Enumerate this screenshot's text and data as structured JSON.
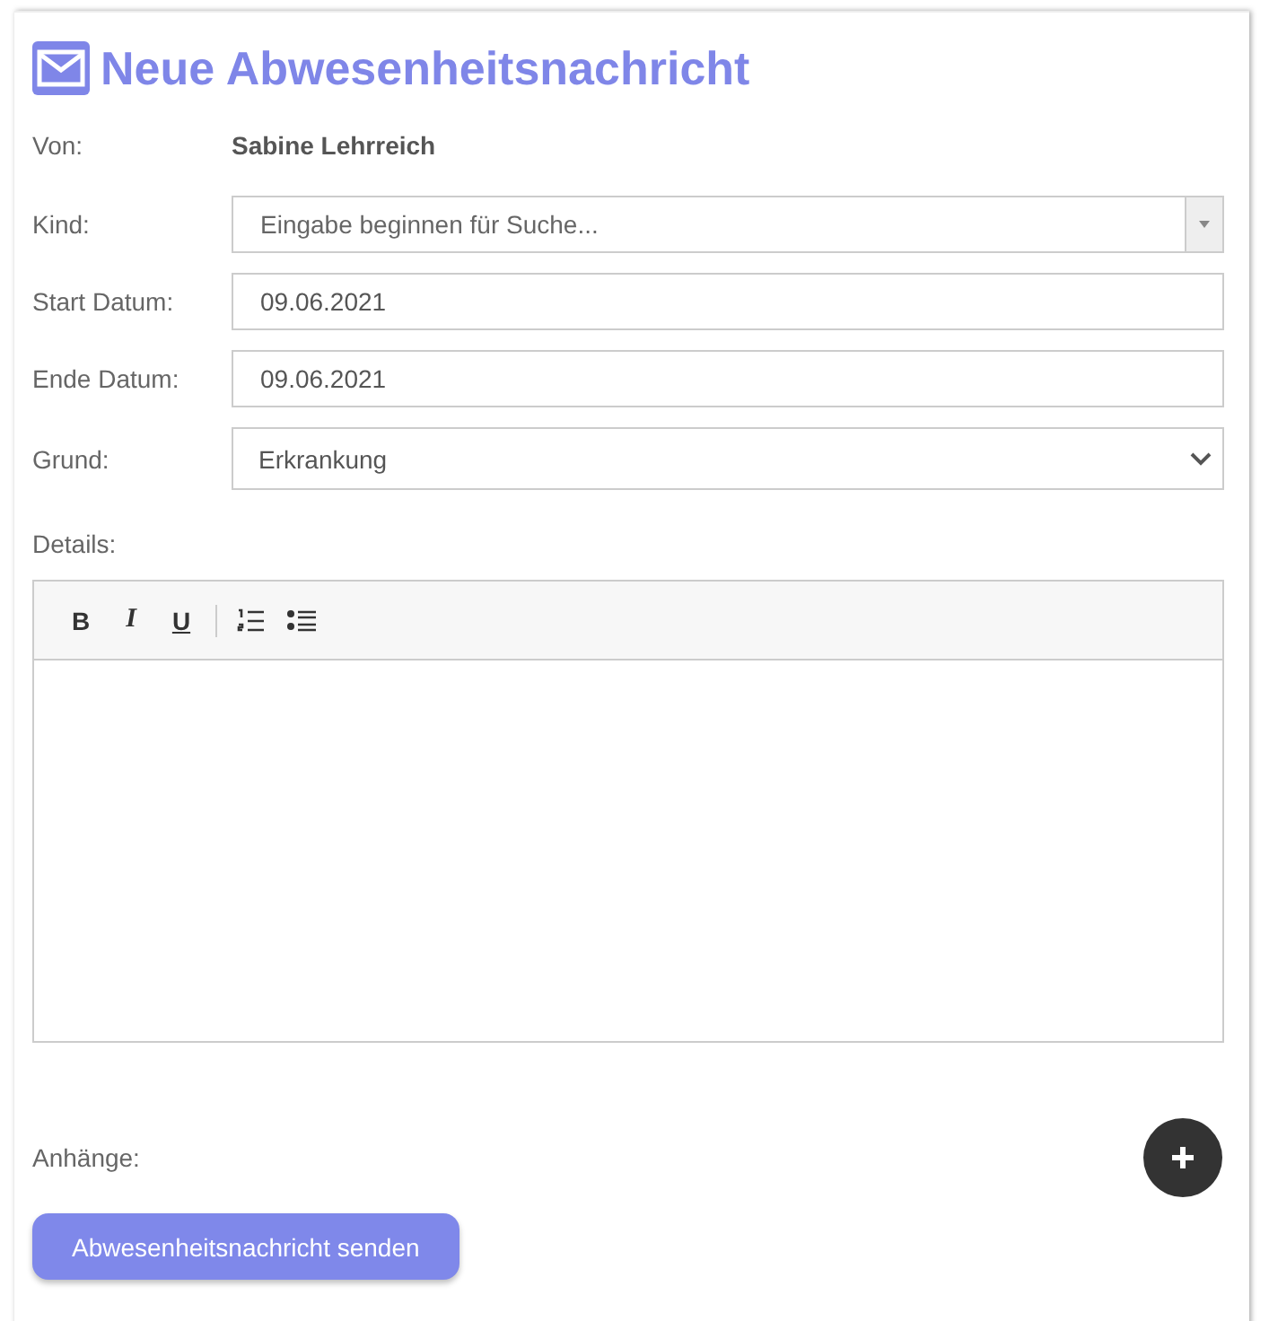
{
  "title": "Neue Abwesenheitsnachricht",
  "fields": [
    {
      "kind": "text",
      "label": "Von:",
      "value": "Sabine Lehrreich"
    },
    {
      "kind": "combobox",
      "label": "Kind:",
      "placeholder": "Eingabe beginnen für Suche..."
    },
    {
      "kind": "input",
      "label": "Start Datum:",
      "value": "09.06.2021"
    },
    {
      "kind": "input",
      "label": "Ende Datum:",
      "value": "09.06.2021"
    },
    {
      "kind": "select",
      "label": "Grund:",
      "value": "Erkrankung"
    }
  ],
  "details": {
    "label": "Details:",
    "format_buttons": [
      "B",
      "I",
      "U"
    ]
  },
  "attachments": {
    "label": "Anhänge:"
  },
  "submit": "Abwesenheitsnachricht senden"
}
